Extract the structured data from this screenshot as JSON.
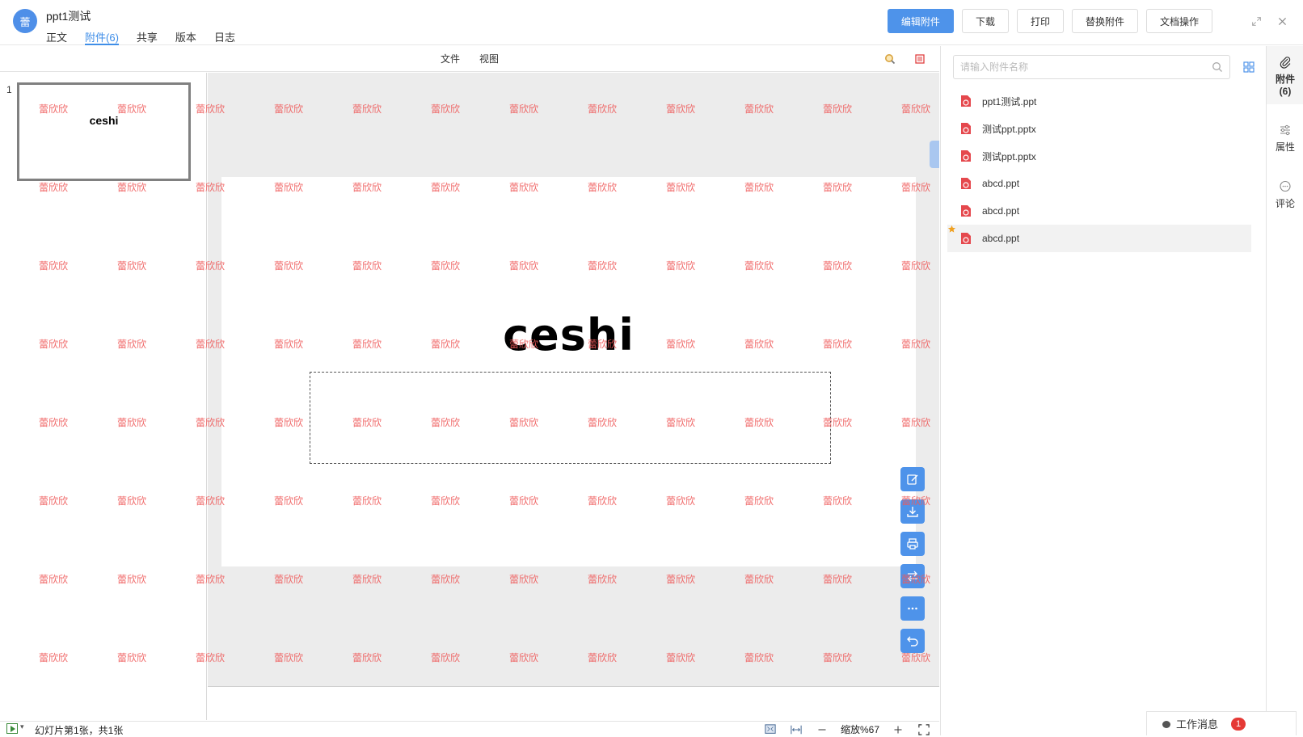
{
  "header": {
    "avatar_text": "蕾",
    "doc_title": "ppt1测试",
    "tabs": [
      {
        "label": "正文"
      },
      {
        "label": "附件(6)"
      },
      {
        "label": "共享"
      },
      {
        "label": "版本"
      },
      {
        "label": "日志"
      }
    ],
    "active_tab": "附件(6)",
    "buttons": {
      "edit": "编辑附件",
      "download": "下载",
      "print": "打印",
      "replace": "替换附件",
      "doc_ops": "文档操作"
    },
    "icons": [
      "expand-icon",
      "close-icon"
    ]
  },
  "viewer": {
    "menu": {
      "file": "文件",
      "view": "视图"
    },
    "slide_number": "1",
    "thumbnail_text": "ceshi",
    "slide_title": "ceshi",
    "watermark_text": "蕾欣欣",
    "status": {
      "slide_count": "幻灯片第1张，共1张",
      "zoom_label": "缩放%67"
    },
    "float_tools": [
      "edit-icon",
      "download-icon",
      "print-icon",
      "swap-icon",
      "more-icon",
      "undo-icon"
    ]
  },
  "attachments": {
    "search_placeholder": "请输入附件名称",
    "files": [
      {
        "name": "ppt1测试.ppt"
      },
      {
        "name": "测试ppt.pptx"
      },
      {
        "name": "测试ppt.pptx"
      },
      {
        "name": "abcd.ppt"
      },
      {
        "name": "abcd.ppt"
      },
      {
        "name": "abcd.ppt",
        "selected": true
      }
    ]
  },
  "side_tabs": {
    "attachments_label": "附件",
    "attachments_count": "(6)",
    "properties_label": "属性",
    "comments_label": "评论"
  },
  "message_bar": {
    "label": "工作消息",
    "badge": "1"
  },
  "colors": {
    "accent": "#4e93ea",
    "watermark": "#ef5a5a",
    "file_icon": "#e5484d"
  }
}
